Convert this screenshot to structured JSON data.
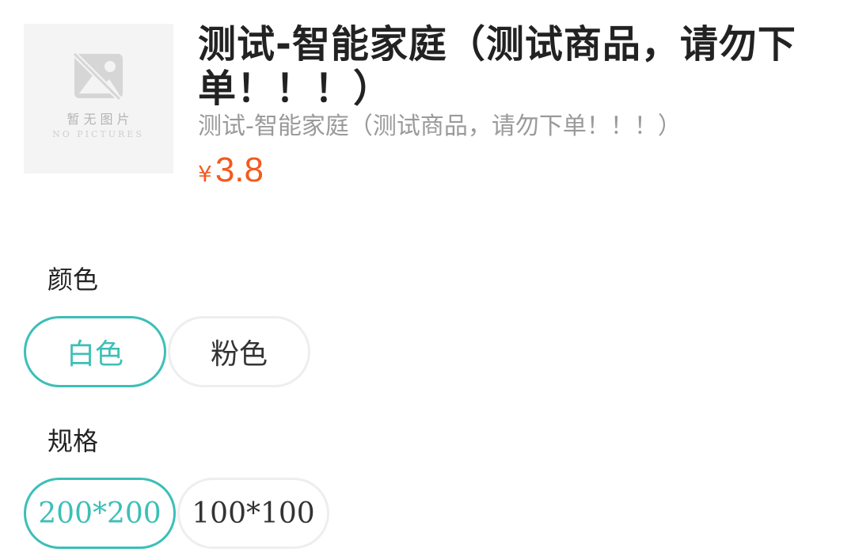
{
  "product": {
    "title": "测试-智能家庭（测试商品，请勿下单！！！）",
    "subtitle": "测试-智能家庭（测试商品，请勿下单！！！）",
    "price_symbol": "¥",
    "price_amount": "3.8",
    "image_placeholder": {
      "text_cn": "暂 无 图 片",
      "text_en": "NO PICTURES",
      "icon": "no-image-icon"
    }
  },
  "specs": {
    "color": {
      "label": "颜色",
      "options": [
        {
          "label": "白色",
          "selected": true
        },
        {
          "label": "粉色",
          "selected": false
        }
      ]
    },
    "size": {
      "label": "规格",
      "options": [
        {
          "label": "200*200",
          "selected": true
        },
        {
          "label": "100*100",
          "selected": false
        }
      ]
    }
  },
  "colors": {
    "accent": "#3cbfb7",
    "price": "#f35a1f",
    "title": "#222222",
    "subtitle": "#9a9a9a",
    "chip_border": "#eeeeee"
  }
}
